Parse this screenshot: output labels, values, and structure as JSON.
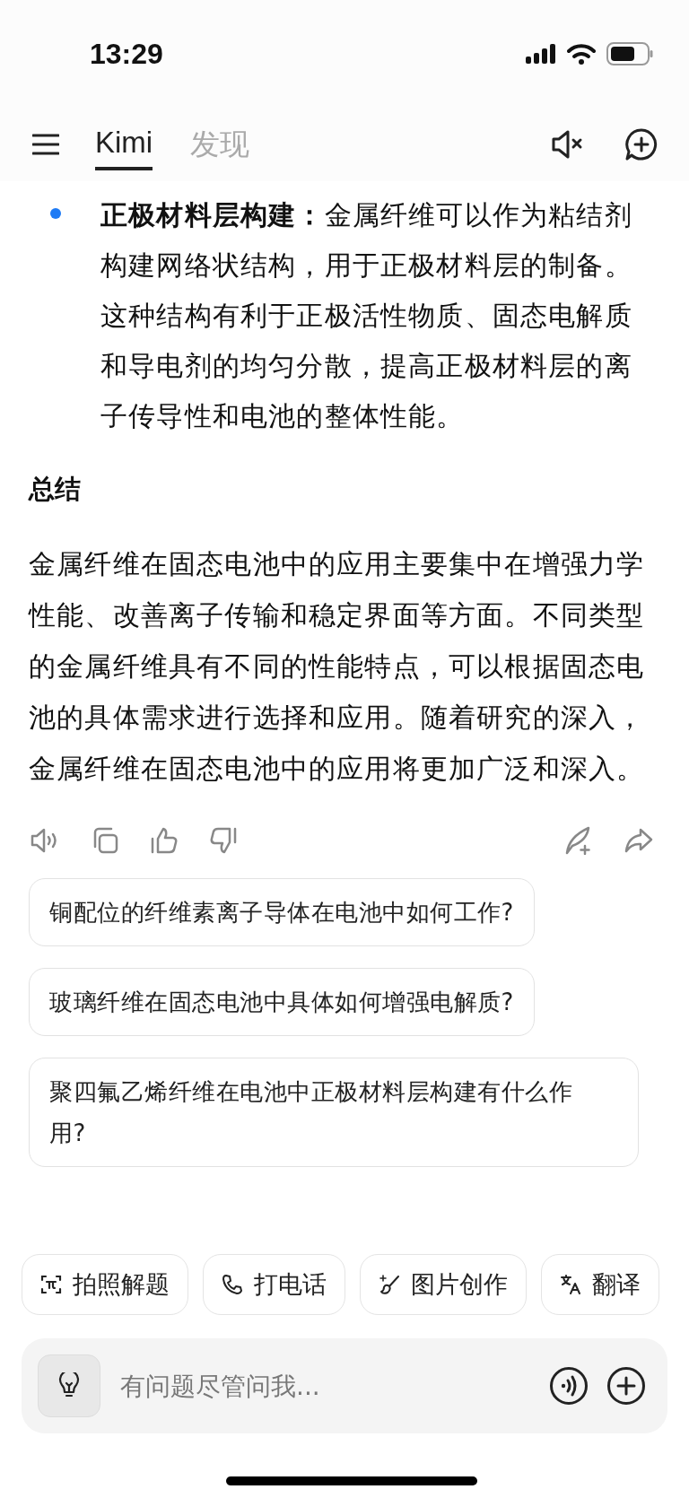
{
  "status_bar": {
    "time": "13:29"
  },
  "tabs": [
    {
      "label": "Kimi",
      "selected": true
    },
    {
      "label": "发现",
      "selected": false
    }
  ],
  "bullet": "**正极材料层构建：**金属纤维可以作为粘结剂构建网络状结构，用于正极材料层的制备。这种结构有利于正极活性物质、固态电解质和导电剂的均匀分散，提高正极材料层的离子传导性和电池的整体性能。",
  "heading": "总结",
  "summary": "金属纤维在固态电池中的应用主要集中在增强力学性能、改善离子传输和稳定界面等方面。不同类型的金属纤维具有不同的性能特点，可以根据固态电池的具体需求进行选择和应用。随着研究的深入，金属纤维在固态电池中的应用将更加广泛和深入。",
  "suggestions": [
    "铜配位的纤维素离子导体在电池中如何工作?",
    "玻璃纤维在固态电池中具体如何增强电解质?",
    "聚四氟乙烯纤维在电池中正极材料层构建有什么作用?"
  ],
  "chips": [
    {
      "kind": "scan",
      "label": "拍照解题"
    },
    {
      "kind": "phone",
      "label": "打电话"
    },
    {
      "kind": "brush",
      "label": "图片创作"
    },
    {
      "kind": "translate",
      "label": "翻译"
    }
  ],
  "input": {
    "placeholder": "有问题尽管问我..."
  }
}
